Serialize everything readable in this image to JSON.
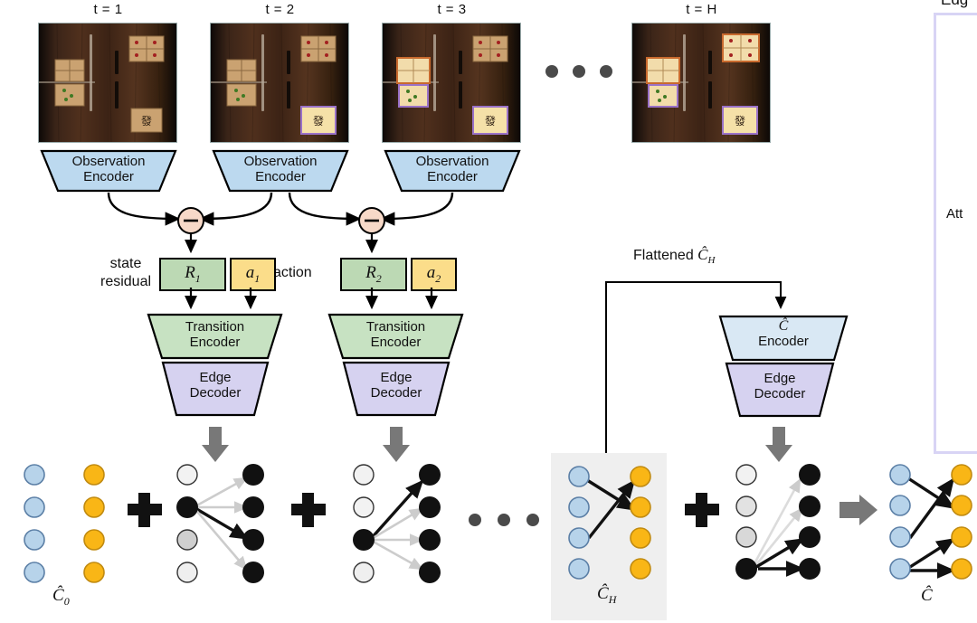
{
  "figure": {
    "type": "model-architecture-diagram",
    "domain": "reinforcement-learning / graph structure inference"
  },
  "timeline": {
    "steps": [
      {
        "id": "t1",
        "label": "t = 1"
      },
      {
        "id": "t2",
        "label": "t = 2"
      },
      {
        "id": "t3",
        "label": "t = 3"
      },
      {
        "id": "tH",
        "label": "t = H"
      }
    ],
    "ellipsis": "• • •"
  },
  "observation": {
    "encoder_label_line1": "Observation",
    "encoder_label_line2": "Encoder",
    "scene_description": "top-down wooden table with mahjong-like tile cards"
  },
  "operators": {
    "minus": "−",
    "plus": "+"
  },
  "annotations": {
    "state_residual_line1": "state",
    "state_residual_line2": "residual",
    "action": "action",
    "flattened": "Flattened",
    "flattened_symbol": "Ĉ",
    "flattened_symbol_sub": "H"
  },
  "blocks": {
    "residual": [
      {
        "symbol": "R",
        "sub": "1"
      },
      {
        "symbol": "R",
        "sub": "2"
      }
    ],
    "action": [
      {
        "symbol": "a",
        "sub": "1"
      },
      {
        "symbol": "a",
        "sub": "2"
      }
    ],
    "transition_encoder_line1": "Transition",
    "transition_encoder_line2": "Encoder",
    "edge_decoder_line1": "Edge",
    "edge_decoder_line2": "Decoder",
    "c_encoder_symbol": "Ĉ",
    "c_encoder_line2": "Encoder"
  },
  "graphs": {
    "c0_label_symbol": "Ĉ",
    "c0_label_sub": "0",
    "cH_label_symbol": "Ĉ",
    "cH_label_sub": "H",
    "c_final_label_symbol": "Ĉ",
    "ellipsis": "• • •"
  },
  "side_panel": {
    "header_partial": "Edg",
    "body_partial": "Att"
  },
  "colors": {
    "observation_encoder_fill": "#bcd9ef",
    "transition_encoder_fill": "#c7e2c2",
    "edge_decoder_fill": "#d6d2f0",
    "c_encoder_fill": "#d9e8f4",
    "residual_fill": "#bcd9b4",
    "action_fill": "#fbdd8a",
    "minus_fill": "#f7d9c8",
    "node_blue": "#b7d3ea",
    "node_blue_stroke": "#5b7fa6",
    "node_orange": "#f9b616",
    "node_orange_stroke": "#c08a10",
    "arrow_grey": "#787878",
    "panel_border": "#d8d4f5",
    "ch_box_bg": "#efefef",
    "edge_strong": "#111111",
    "edge_weak": "#cccccc"
  },
  "chart_data": {
    "type": "diagram",
    "graph_slots": [
      {
        "name": "C0",
        "left_nodes": [
          "blue",
          "blue",
          "blue",
          "blue"
        ],
        "right_nodes": [
          "orange",
          "orange",
          "orange",
          "orange"
        ],
        "edges": []
      },
      {
        "name": "edge-prediction-t1",
        "left_nodes": [
          "white",
          "black",
          "grey",
          "white"
        ],
        "right_nodes": [
          "black",
          "black",
          "black",
          "black"
        ],
        "edges": [
          {
            "from": 1,
            "to": 0,
            "weight": "weak"
          },
          {
            "from": 1,
            "to": 1,
            "weight": "weak"
          },
          {
            "from": 1,
            "to": 2,
            "weight": "strong"
          },
          {
            "from": 1,
            "to": 3,
            "weight": "weak"
          }
        ]
      },
      {
        "name": "edge-prediction-t2",
        "left_nodes": [
          "white",
          "white",
          "black",
          "white"
        ],
        "right_nodes": [
          "black",
          "black",
          "black",
          "black"
        ],
        "edges": [
          {
            "from": 2,
            "to": 0,
            "weight": "strong"
          },
          {
            "from": 2,
            "to": 1,
            "weight": "weak"
          },
          {
            "from": 2,
            "to": 2,
            "weight": "weak"
          },
          {
            "from": 2,
            "to": 3,
            "weight": "weak"
          }
        ]
      },
      {
        "name": "CH",
        "left_nodes": [
          "blue",
          "blue",
          "blue",
          "blue"
        ],
        "right_nodes": [
          "orange",
          "orange",
          "orange",
          "orange"
        ],
        "edges": [
          {
            "from": 0,
            "to": 1,
            "weight": "strong"
          },
          {
            "from": 2,
            "to": 0,
            "weight": "strong"
          }
        ]
      },
      {
        "name": "edge-prediction-final",
        "left_nodes": [
          "white",
          "grey",
          "grey",
          "black"
        ],
        "right_nodes": [
          "black",
          "black",
          "black",
          "black"
        ],
        "edges": [
          {
            "from": 3,
            "to": 0,
            "weight": "weak"
          },
          {
            "from": 3,
            "to": 1,
            "weight": "weak"
          },
          {
            "from": 3,
            "to": 2,
            "weight": "strong"
          },
          {
            "from": 3,
            "to": 3,
            "weight": "strong"
          }
        ]
      },
      {
        "name": "C-final",
        "left_nodes": [
          "blue",
          "blue",
          "blue",
          "blue"
        ],
        "right_nodes": [
          "orange",
          "orange",
          "orange",
          "orange"
        ],
        "edges": [
          {
            "from": 0,
            "to": 1,
            "weight": "strong"
          },
          {
            "from": 2,
            "to": 0,
            "weight": "strong"
          },
          {
            "from": 3,
            "to": 2,
            "weight": "strong"
          },
          {
            "from": 3,
            "to": 3,
            "weight": "strong"
          }
        ]
      }
    ]
  }
}
